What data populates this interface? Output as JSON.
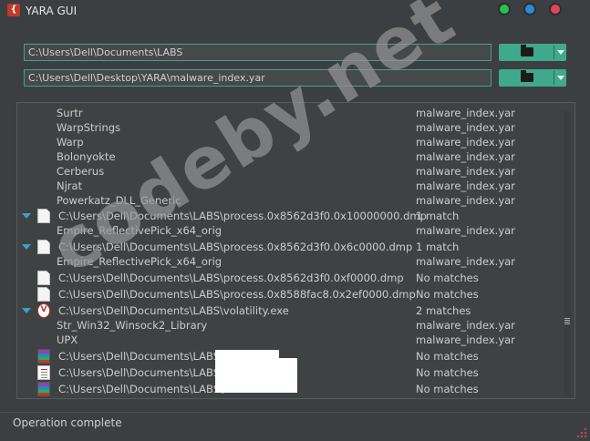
{
  "window": {
    "title": "YARA GUI"
  },
  "inputs": {
    "target_path": "C:\\Users\\Dell\\Documents\\LABS",
    "rules_path": "C:\\Users\\Dell\\Desktop\\YARA\\malware_index.yar"
  },
  "results": [
    {
      "name": "Surtr",
      "result": "malware_index.yar",
      "level": 1
    },
    {
      "name": "WarpStrings",
      "result": "malware_index.yar",
      "level": 1
    },
    {
      "name": "Warp",
      "result": "malware_index.yar",
      "level": 1
    },
    {
      "name": "Bolonyokte",
      "result": "malware_index.yar",
      "level": 1
    },
    {
      "name": "Cerberus",
      "result": "malware_index.yar",
      "level": 1
    },
    {
      "name": "Njrat",
      "result": "malware_index.yar",
      "level": 1
    },
    {
      "name": "Powerkatz_DLL_Generic",
      "result": "malware_index.yar",
      "level": 1
    },
    {
      "name": "C:\\Users\\Dell\\Documents\\LABS\\process.0x8562d3f0.0x10000000.dmp",
      "result": "1 match",
      "level": 0,
      "icon": "document-icon",
      "expanded": true
    },
    {
      "name": "Empire_ReflectivePick_x64_orig",
      "result": "malware_index.yar",
      "level": 1
    },
    {
      "name": "C:\\Users\\Dell\\Documents\\LABS\\process.0x8562d3f0.0x6c0000.dmp",
      "result": "1 match",
      "level": 0,
      "icon": "document-icon",
      "expanded": true
    },
    {
      "name": "Empire_ReflectivePick_x64_orig",
      "result": "malware_index.yar",
      "level": 1
    },
    {
      "name": "C:\\Users\\Dell\\Documents\\LABS\\process.0x8562d3f0.0xf0000.dmp",
      "result": "No matches",
      "level": 0,
      "icon": "document-icon"
    },
    {
      "name": "C:\\Users\\Dell\\Documents\\LABS\\process.0x8588fac8.0x2ef0000.dmp",
      "result": "No matches",
      "level": 0,
      "icon": "document-icon"
    },
    {
      "name": "C:\\Users\\Dell\\Documents\\LABS\\volatility.exe",
      "result": "2 matches",
      "level": 0,
      "icon": "volatility-icon",
      "expanded": true
    },
    {
      "name": "Str_Win32_Winsock2_Library",
      "result": "malware_index.yar",
      "level": 1
    },
    {
      "name": "UPX",
      "result": "malware_index.yar",
      "level": 1
    },
    {
      "name": "C:\\Users\\Dell\\Documents\\LABS\\",
      "result": "No matches",
      "level": 0,
      "icon": "archive-icon"
    },
    {
      "name": "C:\\Users\\Dell\\Documents\\LABS\\",
      "result": "No matches",
      "level": 0,
      "icon": "text-file-icon"
    },
    {
      "name": "C:\\Users\\Dell\\Documents\\LABS\\",
      "result": "No matches",
      "level": 0,
      "icon": "archive-icon"
    }
  ],
  "status": {
    "text": "Operation complete"
  },
  "watermark": {
    "text": "codeby.net"
  },
  "colors": {
    "accent": "#3fa98b",
    "expand": "#3a9fd6",
    "background": "#3c3f41"
  }
}
